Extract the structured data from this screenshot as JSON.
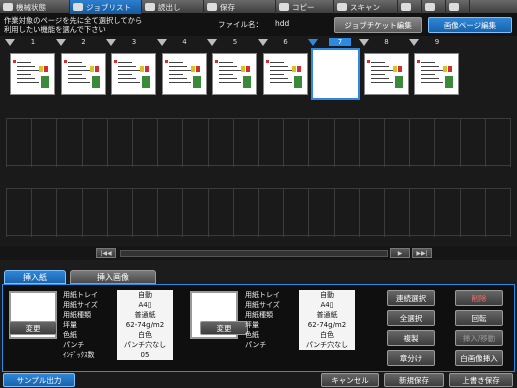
{
  "topbar": {
    "tabs": [
      {
        "label": "機械状態",
        "icon": "machine-icon",
        "width": 70,
        "active": false
      },
      {
        "label": "ジョブリスト",
        "icon": "job-list-icon",
        "width": 72,
        "active": true
      },
      {
        "label": "読出し",
        "icon": "readout-icon",
        "width": 62,
        "active": false
      },
      {
        "label": "保存",
        "icon": "save-icon",
        "width": 72,
        "active": false
      },
      {
        "label": "コピー",
        "icon": "copy-icon",
        "width": 58,
        "active": false
      },
      {
        "label": "スキャン",
        "icon": "scan-icon",
        "width": 64,
        "active": false
      },
      {
        "label": "",
        "icon": "globe-icon",
        "width": 24,
        "active": false
      },
      {
        "label": "",
        "icon": "speaker-icon",
        "width": 24,
        "active": false
      },
      {
        "label": "",
        "icon": "more-icon",
        "width": 24,
        "active": false
      }
    ]
  },
  "header": {
    "instruction_line1": "作業対象のページを先に全て選択してから",
    "instruction_line2": "利用したい機能を選んで下さい",
    "filename_label": "ファイル名：",
    "filename_value": "hdd",
    "job_ticket_button": "ジョブチケット編集",
    "image_page_button": "画像ページ編集"
  },
  "pages": {
    "numbers": [
      "1",
      "2",
      "3",
      "4",
      "5",
      "6",
      "7",
      "8",
      "9"
    ],
    "selected_index": 6
  },
  "scroll": {
    "first": "|◀◀",
    "prev": "◀",
    "next": "▶",
    "last": "▶▶|"
  },
  "panel": {
    "tab_insert_paper": "挿入紙",
    "tab_insert_image": "挿入画像",
    "change_button": "変更",
    "left_props": [
      {
        "k": "用紙トレイ",
        "v": "自動"
      },
      {
        "k": "用紙サイズ",
        "v": "A4▯"
      },
      {
        "k": "用紙種類",
        "v": "普通紙"
      },
      {
        "k": "坪量",
        "v": "62-74g/m2"
      },
      {
        "k": "色紙",
        "v": "白色"
      },
      {
        "k": "パンチ",
        "v": "パンチ穴なし"
      },
      {
        "k": "ｲﾝﾃﾞｯｸｽ数",
        "v": "05"
      }
    ],
    "right_props": [
      {
        "k": "用紙トレイ",
        "v": "自動"
      },
      {
        "k": "用紙サイズ",
        "v": "A4▯"
      },
      {
        "k": "用紙種類",
        "v": "普通紙"
      },
      {
        "k": "坪量",
        "v": "62-74g/m2"
      },
      {
        "k": "色紙",
        "v": "白色"
      },
      {
        "k": "パンチ",
        "v": "パンチ穴なし"
      }
    ],
    "actions": {
      "continuous_select": "連続選択",
      "delete": "削除",
      "select_all": "全選択",
      "rotate": "回転",
      "duplicate": "複製",
      "insert_move": "挿入/移動",
      "chapter_split": "章分け",
      "blank_insert": "白画像挿入"
    }
  },
  "footer": {
    "sample_output": "サンプル出力",
    "cancel": "キャンセル",
    "new_save": "新規保存",
    "overwrite_save": "上書き保存"
  }
}
